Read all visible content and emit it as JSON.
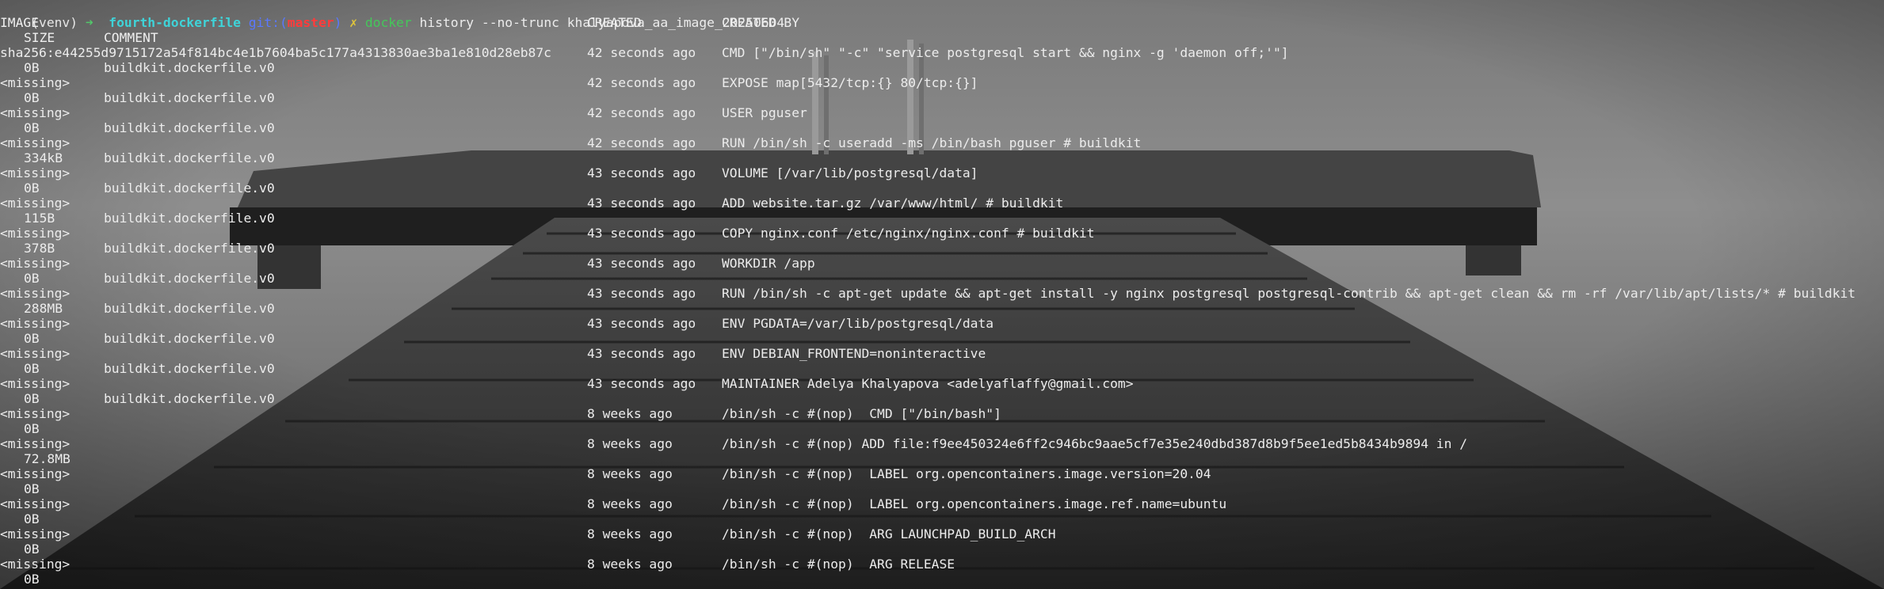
{
  "prompt": {
    "venv": "(venv)",
    "arrow": "➜",
    "dir": "fourth-dockerfile",
    "git_label": "git:",
    "paren_open": "(",
    "branch": "master",
    "paren_close": ")",
    "dirty_mark": "✗",
    "command": "docker",
    "args": "history --no-trunc khalyapova_aa_image_20250604"
  },
  "headers": {
    "image": "IMAGE",
    "created": "CREATED",
    "created_by": "CREATED BY",
    "size": "SIZE",
    "comment": "COMMENT"
  },
  "rows": [
    {
      "image": "sha256:e44255d9715172a54f814bc4e1b7604ba5c177a4313830ae3ba1e810d28eb87c",
      "created": "42 seconds ago",
      "created_by": "CMD [\"/bin/sh\" \"-c\" \"service postgresql start && nginx -g 'daemon off;'\"]",
      "size": "0B",
      "comment": "buildkit.dockerfile.v0"
    },
    {
      "image": "<missing>",
      "created": "42 seconds ago",
      "created_by": "EXPOSE map[5432/tcp:{} 80/tcp:{}]",
      "size": "0B",
      "comment": "buildkit.dockerfile.v0"
    },
    {
      "image": "<missing>",
      "created": "42 seconds ago",
      "created_by": "USER pguser",
      "size": "0B",
      "comment": "buildkit.dockerfile.v0"
    },
    {
      "image": "<missing>",
      "created": "42 seconds ago",
      "created_by": "RUN /bin/sh -c useradd -ms /bin/bash pguser # buildkit",
      "size": "334kB",
      "comment": "buildkit.dockerfile.v0"
    },
    {
      "image": "<missing>",
      "created": "43 seconds ago",
      "created_by": "VOLUME [/var/lib/postgresql/data]",
      "size": "0B",
      "comment": "buildkit.dockerfile.v0"
    },
    {
      "image": "<missing>",
      "created": "43 seconds ago",
      "created_by": "ADD website.tar.gz /var/www/html/ # buildkit",
      "size": "115B",
      "comment": "buildkit.dockerfile.v0"
    },
    {
      "image": "<missing>",
      "created": "43 seconds ago",
      "created_by": "COPY nginx.conf /etc/nginx/nginx.conf # buildkit",
      "size": "378B",
      "comment": "buildkit.dockerfile.v0"
    },
    {
      "image": "<missing>",
      "created": "43 seconds ago",
      "created_by": "WORKDIR /app",
      "size": "0B",
      "comment": "buildkit.dockerfile.v0"
    },
    {
      "image": "<missing>",
      "created": "43 seconds ago",
      "created_by": "RUN /bin/sh -c apt-get update && apt-get install -y nginx postgresql postgresql-contrib && apt-get clean && rm -rf /var/lib/apt/lists/* # buildkit",
      "size": "288MB",
      "comment": "buildkit.dockerfile.v0"
    },
    {
      "image": "<missing>",
      "created": "43 seconds ago",
      "created_by": "ENV PGDATA=/var/lib/postgresql/data",
      "size": "0B",
      "comment": "buildkit.dockerfile.v0"
    },
    {
      "image": "<missing>",
      "created": "43 seconds ago",
      "created_by": "ENV DEBIAN_FRONTEND=noninteractive",
      "size": "0B",
      "comment": "buildkit.dockerfile.v0"
    },
    {
      "image": "<missing>",
      "created": "43 seconds ago",
      "created_by": "MAINTAINER Adelya Khalyapova <adelyaflaffy@gmail.com>",
      "size": "0B",
      "comment": "buildkit.dockerfile.v0"
    },
    {
      "image": "<missing>",
      "created": "8 weeks ago",
      "created_by": "/bin/sh -c #(nop)  CMD [\"/bin/bash\"]",
      "size": "0B",
      "comment": ""
    },
    {
      "image": "<missing>",
      "created": "8 weeks ago",
      "created_by": "/bin/sh -c #(nop) ADD file:f9ee450324e6ff2c946bc9aae5cf7e35e240dbd387d8b9f5ee1ed5b8434b9894 in /",
      "size": "72.8MB",
      "comment": ""
    },
    {
      "image": "<missing>",
      "created": "8 weeks ago",
      "created_by": "/bin/sh -c #(nop)  LABEL org.opencontainers.image.version=20.04",
      "size": "0B",
      "comment": ""
    },
    {
      "image": "<missing>",
      "created": "8 weeks ago",
      "created_by": "/bin/sh -c #(nop)  LABEL org.opencontainers.image.ref.name=ubuntu",
      "size": "0B",
      "comment": ""
    },
    {
      "image": "<missing>",
      "created": "8 weeks ago",
      "created_by": "/bin/sh -c #(nop)  ARG LAUNCHPAD_BUILD_ARCH",
      "size": "0B",
      "comment": ""
    },
    {
      "image": "<missing>",
      "created": "8 weeks ago",
      "created_by": "/bin/sh -c #(nop)  ARG RELEASE",
      "size": "0B",
      "comment": ""
    }
  ],
  "colors": {
    "text": "#ececec",
    "prompt_dir": "#3fd3d8",
    "prompt_git": "#5a78ff",
    "prompt_branch": "#ff3b3b",
    "prompt_dirty": "#e0c53a",
    "prompt_command": "#44c85a"
  }
}
